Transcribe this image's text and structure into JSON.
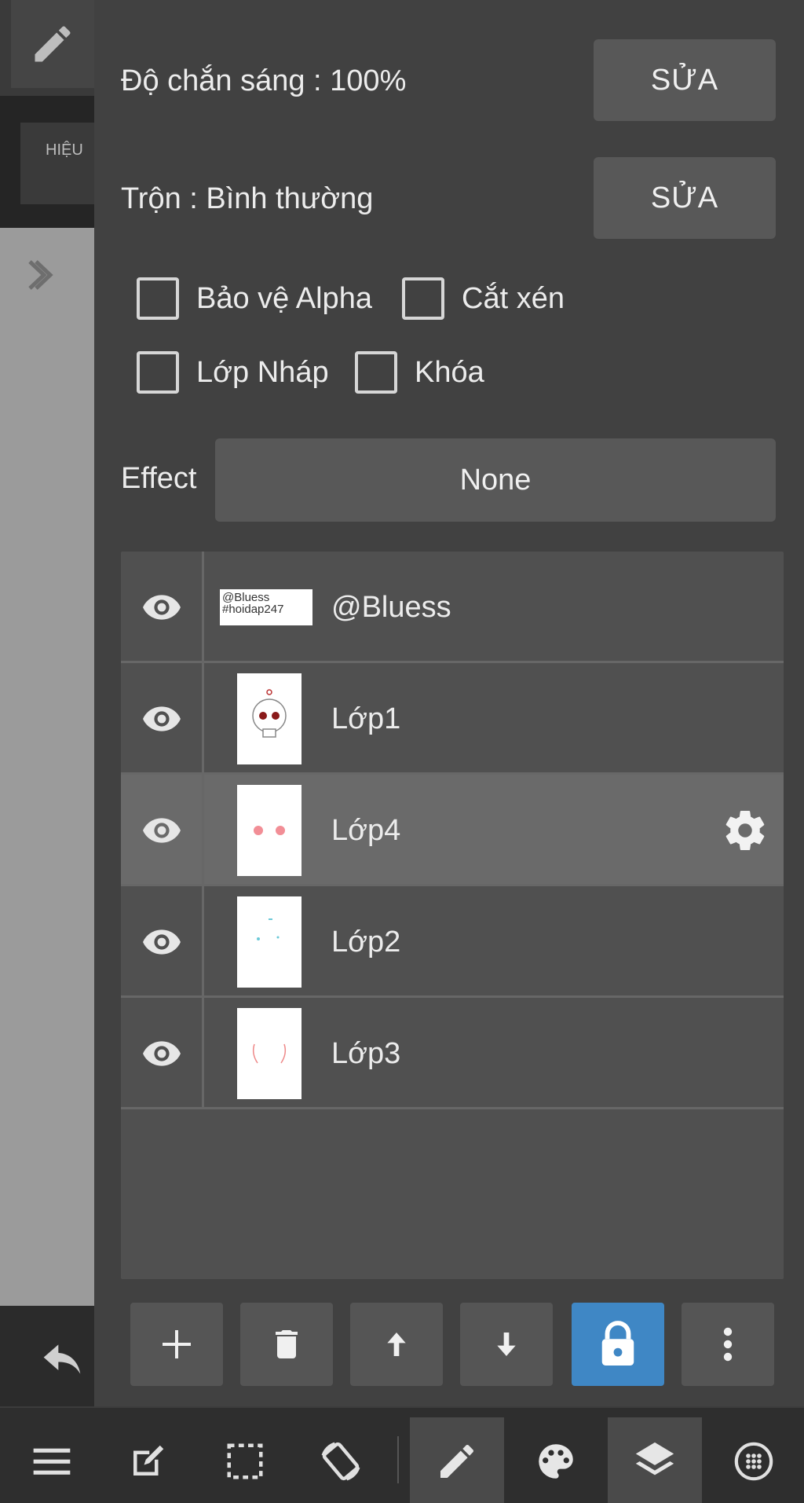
{
  "left": {
    "effect_tab_label": "HIỆU"
  },
  "properties": {
    "opacity_label": "Độ chắn sáng : 100%",
    "opacity_edit_label": "SỬA",
    "blend_label": "Trộn : Bình thường",
    "blend_edit_label": "SỬA",
    "checkboxes": [
      {
        "label": "Bảo vệ Alpha",
        "checked": false
      },
      {
        "label": "Cắt xén",
        "checked": false
      },
      {
        "label": "Lớp Nháp",
        "checked": false
      },
      {
        "label": "Khóa",
        "checked": false
      }
    ],
    "effect_label": "Effect",
    "effect_value": "None"
  },
  "layers": [
    {
      "name": "@Bluess",
      "thumb_text": "@Bluess\n#hoidap247",
      "visible": true,
      "selected": false
    },
    {
      "name": "Lớp1",
      "visible": true,
      "selected": false
    },
    {
      "name": "Lớp4",
      "visible": true,
      "selected": true
    },
    {
      "name": "Lớp2",
      "visible": true,
      "selected": false
    },
    {
      "name": "Lớp3",
      "visible": true,
      "selected": false
    }
  ],
  "layer_actions": [
    "add-layer",
    "delete-layer",
    "move-layer-up",
    "move-layer-down",
    "lock-layer",
    "more-options"
  ],
  "colors": {
    "accent": "#3f87c5",
    "panel_bg": "#414141",
    "button_bg": "#585858",
    "selected_row": "#6a6a6a"
  },
  "toolbar": [
    "menu-icon",
    "edit-canvas-icon",
    "selection-icon",
    "rotate-icon",
    "pen-icon",
    "palette-icon",
    "layers-icon",
    "material-icon"
  ]
}
